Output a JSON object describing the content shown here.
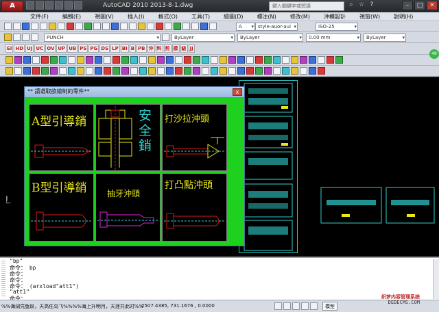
{
  "window": {
    "app_button": "A",
    "title": "AutoCAD 2010    2013-8-1.dwg",
    "search_placeholder": "鍵入關鍵字或短語",
    "min": "–",
    "max": "□",
    "close": "✕"
  },
  "menu": [
    "文件(F)",
    "編輯(E)",
    "視圖(V)",
    "插入(I)",
    "格式(O)",
    "工具(T)",
    "繪圖(D)",
    "標注(N)",
    "修改(M)",
    "沖模設計",
    "視窗(W)",
    "說明(H)"
  ],
  "toolbar": {
    "text_style": "style-auor-aui",
    "dim_style": "ISO-25",
    "punch_layer": "PUNCH",
    "color": "ByLayer",
    "linetype": "ByLayer",
    "lineweight": "0.00 mm",
    "plot_style": "ByLayer",
    "zero": "0"
  },
  "red_commands": [
    "EI",
    "HD",
    "UJ",
    "UC",
    "OV",
    "UP",
    "UB",
    "PS",
    "PG",
    "DS",
    "LP",
    "BI",
    "B",
    "PB",
    "沖",
    "料",
    "剪",
    "模",
    "級",
    "JJ"
  ],
  "side_badge": "48",
  "dialog": {
    "title": "** 請選取欲繪制的零件**",
    "close": "x",
    "parts": [
      {
        "label": "A型引導銷"
      },
      {
        "label": "安全銷"
      },
      {
        "label": "打沙拉沖頭"
      },
      {
        "label": "B型引導銷"
      },
      {
        "label": "抽牙沖頭"
      },
      {
        "label": "打凸點沖頭"
      }
    ]
  },
  "command_line": {
    "lines": [
      "\"bp\"",
      "命令： bp",
      "命令：",
      "命令：",
      "命令： (arxload\"att1\")",
      "\"att1\"",
      "命令："
    ]
  },
  "status": {
    "message": "%%海阔凭鱼跃，天高任鸟飞%%%%海上升明月，天涯共此时%%",
    "coords": "2507.4385, 731.1676 , 0.0000",
    "model": "模型"
  },
  "watermark": {
    "line1": "织梦内容管理系统",
    "line2": "DEDECMS.COM"
  },
  "colors": {
    "dialog_bg": "#1fd11f",
    "canvas_bg": "#000000",
    "part_yellow": "#e8e818",
    "part_cyan": "#2fd0d0",
    "part_red": "#d81818",
    "part_magenta": "#e020e0"
  }
}
